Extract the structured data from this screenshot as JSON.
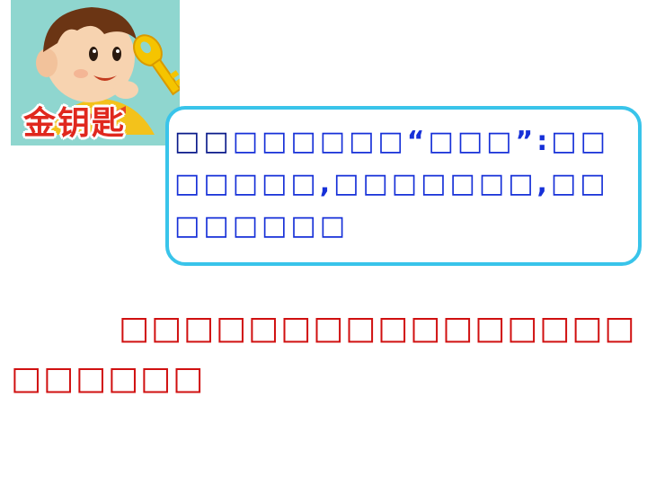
{
  "logo": {
    "text": "金钥匙",
    "icon": "boy-with-golden-key-icon"
  },
  "hint": {
    "lead": "□□",
    "body": "□□□□□□“□□□”:□□□□□□□,□□□□□□□,□□□□□□□□"
  },
  "main": {
    "text": "□□□□□□□□□□□□□□□□□□□□□□"
  }
}
